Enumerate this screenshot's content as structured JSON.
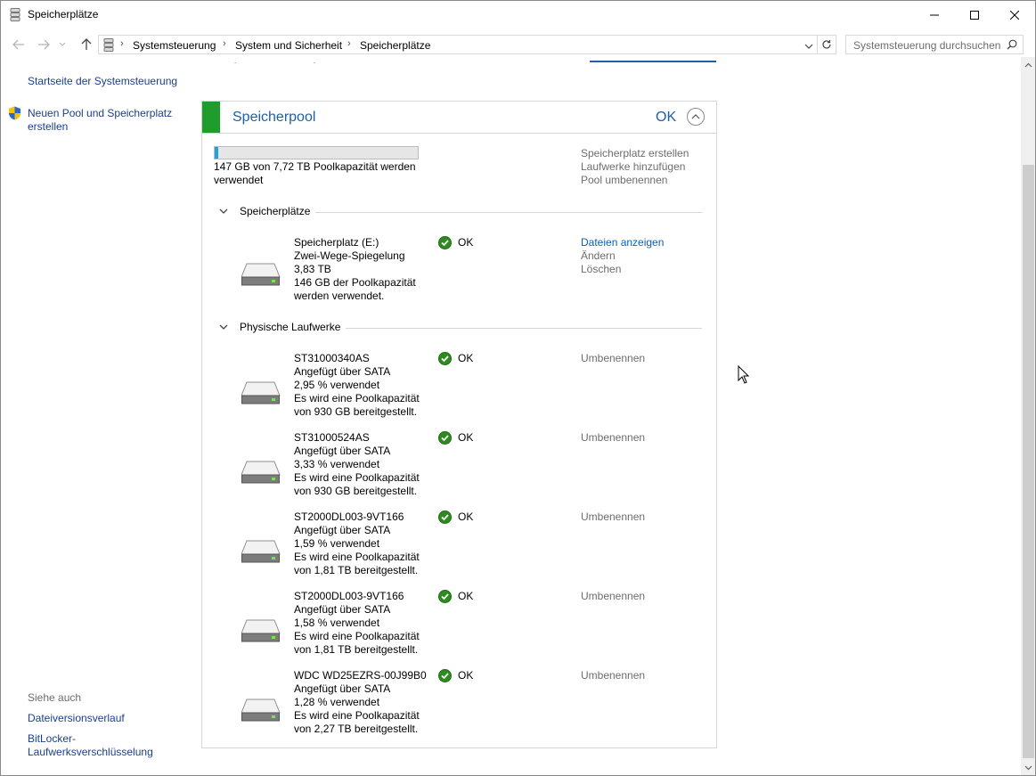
{
  "window": {
    "title": "Speicherplätze",
    "controls": {
      "minimize": "minimize",
      "maximize": "maximize",
      "close": "close"
    }
  },
  "address": {
    "crumbs": [
      "Systemsteuerung",
      "System und Sicherheit",
      "Speicherplätze"
    ],
    "search_placeholder": "Systemsteuerung durchsuchen"
  },
  "left_pane": {
    "home_link": "Startseite der Systemsteuerung",
    "create_link_line1": "Neuen Pool und Speicherplatz",
    "create_link_line2": "erstellen",
    "see_also_heading": "Siehe auch",
    "see_also_1": "Dateiversionsverlauf",
    "see_also_2_line1": "BitLocker-",
    "see_also_2_line2": "Laufwerksverschlüsselung"
  },
  "pool": {
    "title": "Speicherpool",
    "status": "OK",
    "accent_color": "#1f9d2c",
    "usage_fraction": 0.019,
    "usage_line1": "147 GB von 7,72 TB Poolkapazität werden",
    "usage_line2": "verwendet",
    "actions": [
      "Speicherplatz erstellen",
      "Laufwerke hinzufügen",
      "Pool umbenennen"
    ]
  },
  "spaces_section": {
    "title": "Speicherplätze",
    "items": [
      {
        "lines": [
          "Speicherplatz (E:)",
          "Zwei-Wege-Spiegelung",
          "3,83 TB",
          "146 GB der Poolkapazität",
          "werden verwendet."
        ],
        "status": "OK",
        "actions": [
          "Dateien anzeigen",
          "Ändern",
          "Löschen"
        ]
      }
    ]
  },
  "drives_section": {
    "title": "Physische Laufwerke",
    "items": [
      {
        "lines": [
          "ST31000340AS",
          "Angefügt über SATA",
          "2,95 % verwendet",
          "Es wird eine Poolkapazität",
          "von 930 GB bereitgestellt."
        ],
        "status": "OK",
        "action": "Umbenennen"
      },
      {
        "lines": [
          "ST31000524AS",
          "Angefügt über SATA",
          "3,33 % verwendet",
          "Es wird eine Poolkapazität",
          "von 930 GB bereitgestellt."
        ],
        "status": "OK",
        "action": "Umbenennen"
      },
      {
        "lines": [
          "ST2000DL003-9VT166",
          "Angefügt über SATA",
          "1,59 % verwendet",
          "Es wird eine Poolkapazität",
          "von 1,81 TB bereitgestellt."
        ],
        "status": "OK",
        "action": "Umbenennen"
      },
      {
        "lines": [
          "ST2000DL003-9VT166",
          "Angefügt über SATA",
          "1,58 % verwendet",
          "Es wird eine Poolkapazität",
          "von 1,81 TB bereitgestellt."
        ],
        "status": "OK",
        "action": "Umbenennen"
      },
      {
        "lines": [
          "WDC WD25EZRS-00J99B0",
          "Angefügt über SATA",
          "1,28 % verwendet",
          "Es wird eine Poolkapazität",
          "von 2,27 TB bereitgestellt."
        ],
        "status": "OK",
        "action": "Umbenennen"
      }
    ]
  },
  "colors": {
    "link": "#1a3f8a",
    "title_blue": "#1f5fa6",
    "ok_green": "#2e8b1f",
    "disabled": "#6d6d6d"
  }
}
